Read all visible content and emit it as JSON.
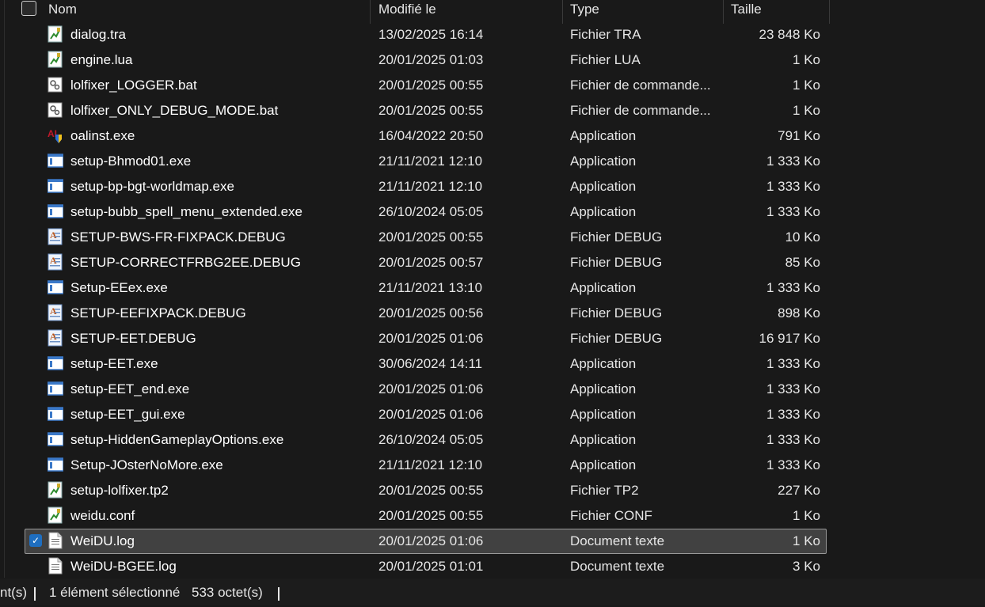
{
  "header": {
    "name": "Nom",
    "modified": "Modifié le",
    "type": "Type",
    "size": "Taille"
  },
  "files": [
    {
      "name": "dialog.tra",
      "modified": "13/02/2025 16:14",
      "type": "Fichier TRA",
      "size": "23 848 Ko",
      "icon": "text-document-icon"
    },
    {
      "name": "engine.lua",
      "modified": "20/01/2025 01:03",
      "type": "Fichier LUA",
      "size": "1 Ko",
      "icon": "text-document-icon"
    },
    {
      "name": "lolfixer_LOGGER.bat",
      "modified": "20/01/2025 00:55",
      "type": "Fichier de commande...",
      "size": "1 Ko",
      "icon": "batch-file-icon"
    },
    {
      "name": "lolfixer_ONLY_DEBUG_MODE.bat",
      "modified": "20/01/2025 00:55",
      "type": "Fichier de commande...",
      "size": "1 Ko",
      "icon": "batch-file-icon"
    },
    {
      "name": "oalinst.exe",
      "modified": "16/04/2022 20:50",
      "type": "Application",
      "size": "791 Ko",
      "icon": "installer-icon"
    },
    {
      "name": "setup-Bhmod01.exe",
      "modified": "21/11/2021 12:10",
      "type": "Application",
      "size": "1 333 Ko",
      "icon": "application-icon"
    },
    {
      "name": "setup-bp-bgt-worldmap.exe",
      "modified": "21/11/2021 12:10",
      "type": "Application",
      "size": "1 333 Ko",
      "icon": "application-icon"
    },
    {
      "name": "setup-bubb_spell_menu_extended.exe",
      "modified": "26/10/2024 05:05",
      "type": "Application",
      "size": "1 333 Ko",
      "icon": "application-icon"
    },
    {
      "name": "SETUP-BWS-FR-FIXPACK.DEBUG",
      "modified": "20/01/2025 00:55",
      "type": "Fichier DEBUG",
      "size": "10 Ko",
      "icon": "debug-file-icon"
    },
    {
      "name": "SETUP-CORRECTFRBG2EE.DEBUG",
      "modified": "20/01/2025 00:57",
      "type": "Fichier DEBUG",
      "size": "85 Ko",
      "icon": "debug-file-icon"
    },
    {
      "name": "Setup-EEex.exe",
      "modified": "21/11/2021 13:10",
      "type": "Application",
      "size": "1 333 Ko",
      "icon": "application-icon"
    },
    {
      "name": "SETUP-EEFIXPACK.DEBUG",
      "modified": "20/01/2025 00:56",
      "type": "Fichier DEBUG",
      "size": "898 Ko",
      "icon": "debug-file-icon"
    },
    {
      "name": "SETUP-EET.DEBUG",
      "modified": "20/01/2025 01:06",
      "type": "Fichier DEBUG",
      "size": "16 917 Ko",
      "icon": "debug-file-icon"
    },
    {
      "name": "setup-EET.exe",
      "modified": "30/06/2024 14:11",
      "type": "Application",
      "size": "1 333 Ko",
      "icon": "application-icon"
    },
    {
      "name": "setup-EET_end.exe",
      "modified": "20/01/2025 01:06",
      "type": "Application",
      "size": "1 333 Ko",
      "icon": "application-icon"
    },
    {
      "name": "setup-EET_gui.exe",
      "modified": "20/01/2025 01:06",
      "type": "Application",
      "size": "1 333 Ko",
      "icon": "application-icon"
    },
    {
      "name": "setup-HiddenGameplayOptions.exe",
      "modified": "26/10/2024 05:05",
      "type": "Application",
      "size": "1 333 Ko",
      "icon": "application-icon"
    },
    {
      "name": "Setup-JOsterNoMore.exe",
      "modified": "21/11/2021 12:10",
      "type": "Application",
      "size": "1 333 Ko",
      "icon": "application-icon"
    },
    {
      "name": "setup-lolfixer.tp2",
      "modified": "20/01/2025 00:55",
      "type": "Fichier TP2",
      "size": "227 Ko",
      "icon": "text-document-icon"
    },
    {
      "name": "weidu.conf",
      "modified": "20/01/2025 00:55",
      "type": "Fichier CONF",
      "size": "1 Ko",
      "icon": "text-document-icon"
    },
    {
      "name": "WeiDU.log",
      "modified": "20/01/2025 01:06",
      "type": "Document texte",
      "size": "1 Ko",
      "icon": "plain-text-icon",
      "selected": true
    },
    {
      "name": "WeiDU-BGEE.log",
      "modified": "20/01/2025 01:01",
      "type": "Document texte",
      "size": "3 Ko",
      "icon": "plain-text-icon"
    }
  ],
  "status": {
    "count_fragment": "nt(s)",
    "selection": "1 élément sélectionné",
    "selection_size": "533 octet(s)"
  },
  "colors": {
    "background": "#191919",
    "selected_row": "#414141",
    "checkbox_accent": "#1e6ec0"
  }
}
